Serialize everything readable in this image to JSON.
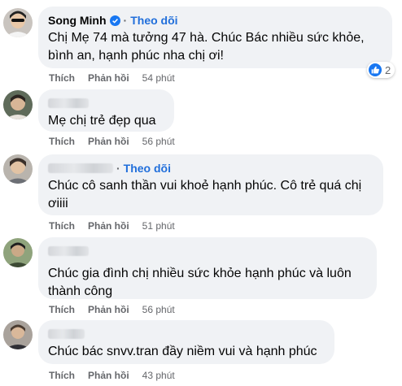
{
  "labels": {
    "like": "Thích",
    "reply": "Phản hồi",
    "follow": "Theo dõi",
    "dot": "·"
  },
  "comments": [
    {
      "author": "Song Minh",
      "text": "Chị Mẹ 74 mà tưởng 47 hà. Chúc Bác nhiều sức khỏe, bình an, hạnh phúc nha chị ơi!",
      "time": "54 phút",
      "reactions": "2"
    },
    {
      "author": "",
      "text": "Mẹ chị trẻ đẹp qua",
      "time": "56 phút"
    },
    {
      "author": "",
      "text": "Chúc cô sanh thần vui khoẻ hạnh phúc. Cô trẻ quá chị ơiiii",
      "time": "51 phút"
    },
    {
      "author": "",
      "text": "Chúc gia đình chị nhiều sức khỏe hạnh phúc và luôn thành công",
      "time": "56 phút"
    },
    {
      "author": "",
      "text": "Chúc bác snvv.tran đầy niềm vui và hạnh phúc",
      "time": "43 phút"
    }
  ],
  "colors": {
    "bubble": "#f0f2f5",
    "follow": "#216fdb",
    "meta": "#65676b",
    "like": "#1877f2"
  }
}
